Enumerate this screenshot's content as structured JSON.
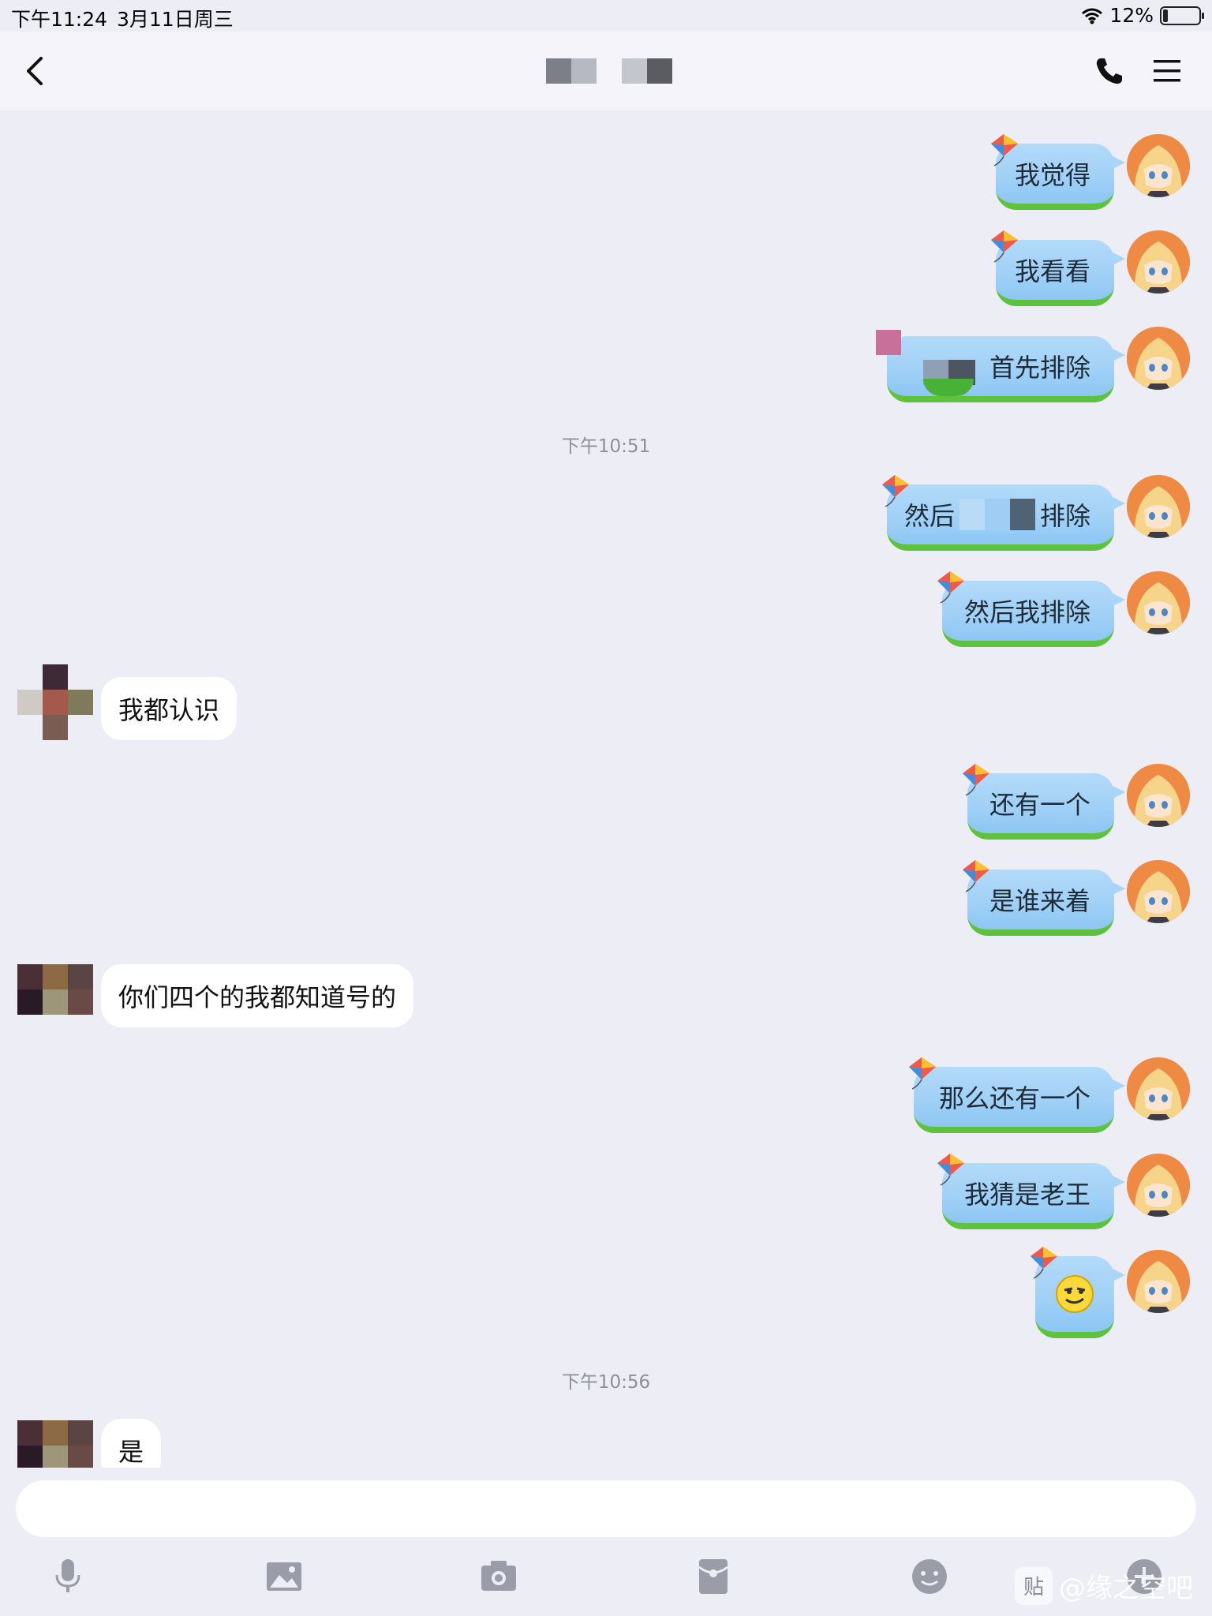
{
  "status_bar": {
    "time": "下午11:24",
    "date": "3月11日周三",
    "battery": "12%"
  },
  "nav": {
    "back_icon": "chevron-left-icon",
    "call_icon": "phone-icon",
    "menu_icon": "hamburger-menu-icon"
  },
  "timestamps": [
    "下午10:51",
    "下午10:56"
  ],
  "messages": [
    {
      "side": "me",
      "text": "我觉得"
    },
    {
      "side": "me",
      "text": "我看看"
    },
    {
      "side": "me",
      "text": "首先排除"
    },
    {
      "side": "me",
      "text": "然后"
    },
    {
      "side": "me",
      "text": "排除"
    },
    {
      "side": "me",
      "text": "然后我排除"
    },
    {
      "side": "other",
      "text": "我都认识"
    },
    {
      "side": "me",
      "text": "还有一个"
    },
    {
      "side": "me",
      "text": "是谁来着"
    },
    {
      "side": "other",
      "text": "你们四个的我都知道号的"
    },
    {
      "side": "me",
      "text": "那么还有一个"
    },
    {
      "side": "me",
      "text": "我猜是老王"
    },
    {
      "side": "me",
      "text": "",
      "emoji": "smirk-emoji"
    },
    {
      "side": "other",
      "text": "是"
    }
  ],
  "input": {
    "placeholder": ""
  },
  "toolbar": {
    "icons": [
      "microphone-icon",
      "image-icon",
      "camera-icon",
      "red-envelope-icon",
      "emoji-icon",
      "plus-icon"
    ]
  },
  "watermark": {
    "badge": "贴",
    "text": "@缘之空吧"
  },
  "colors": {
    "background": "#ecedf5",
    "bubble_me": "#a9d5f7",
    "bubble_me_grass": "#5fc23d",
    "bubble_other": "#ffffff",
    "avatar_me": "#ef8a45"
  }
}
